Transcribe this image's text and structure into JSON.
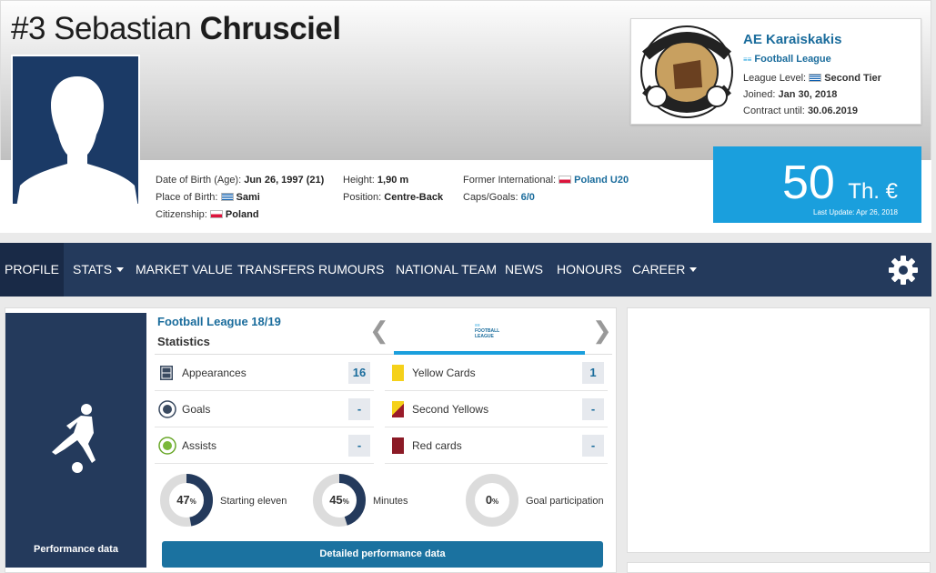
{
  "player": {
    "number": "#3",
    "first_name": "Sebastian",
    "last_name": "Chrusciel"
  },
  "details": {
    "dob_label": "Date of Birth (Age):",
    "dob_value": "Jun 26, 1997 (21)",
    "pob_label": "Place of Birth:",
    "pob_value": "Sami",
    "citizenship_label": "Citizenship:",
    "citizenship_value": "Poland",
    "height_label": "Height:",
    "height_value": "1,90 m",
    "position_label": "Position:",
    "position_value": "Centre-Back",
    "former_int_label": "Former International:",
    "former_int_value": "Poland U20",
    "caps_label": "Caps/Goals:",
    "caps_value": "6/0"
  },
  "club": {
    "name": "AE Karaiskakis",
    "league": "Football League",
    "level_label": "League Level:",
    "level_value": "Second Tier",
    "joined_label": "Joined:",
    "joined_value": "Jan 30, 2018",
    "contract_label": "Contract until:",
    "contract_value": "30.06.2019"
  },
  "market_value": {
    "amount": "50",
    "unit": "Th. €",
    "last_update": "Last Update: Apr 26, 2018"
  },
  "nav": {
    "items": [
      "PROFILE",
      "STATS",
      "MARKET VALUE",
      "TRANSFERS",
      "RUMOURS",
      "NATIONAL TEAM",
      "NEWS",
      "HONOURS",
      "CAREER"
    ]
  },
  "performance": {
    "side_label": "Performance data",
    "league_title": "Football League 18/19",
    "stats_title": "Statistics",
    "tab_logo_text": "FOOTBALL LEAGUE",
    "rows_left": [
      {
        "label": "Appearances",
        "value": "16",
        "icon": "pitch-icon"
      },
      {
        "label": "Goals",
        "value": "-",
        "icon": "ball-icon"
      },
      {
        "label": "Assists",
        "value": "-",
        "icon": "assist-ball-icon"
      }
    ],
    "rows_right": [
      {
        "label": "Yellow Cards",
        "value": "1",
        "icon": "yellow-card-icon"
      },
      {
        "label": "Second Yellows",
        "value": "-",
        "icon": "second-yellow-icon"
      },
      {
        "label": "Red cards",
        "value": "-",
        "icon": "red-card-icon"
      }
    ],
    "donuts": [
      {
        "label": "Starting eleven",
        "pct": 47,
        "display": "47"
      },
      {
        "label": "Minutes",
        "pct": 45,
        "display": "45"
      },
      {
        "label": "Goal participation",
        "pct": 0,
        "display": "0"
      }
    ],
    "percent_sign": "%",
    "detail_button": "Detailed performance data"
  },
  "colors": {
    "nav_bg": "#243a5c",
    "accent": "#1a9fdd",
    "link": "#1a6c9c"
  }
}
